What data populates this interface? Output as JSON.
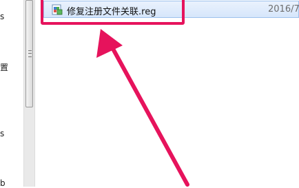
{
  "nav_pane": {
    "items": [
      {
        "label": "s"
      },
      {
        "label": "置"
      },
      {
        "label": "s"
      },
      {
        "label": "b"
      }
    ]
  },
  "file_list": {
    "selected_file": {
      "name": "修复注册文件关联.reg",
      "date": "2016/7",
      "icon": "registry-file-icon"
    }
  },
  "annotation": {
    "highlight_color": "#e6135c",
    "arrow_color": "#e6135c"
  }
}
